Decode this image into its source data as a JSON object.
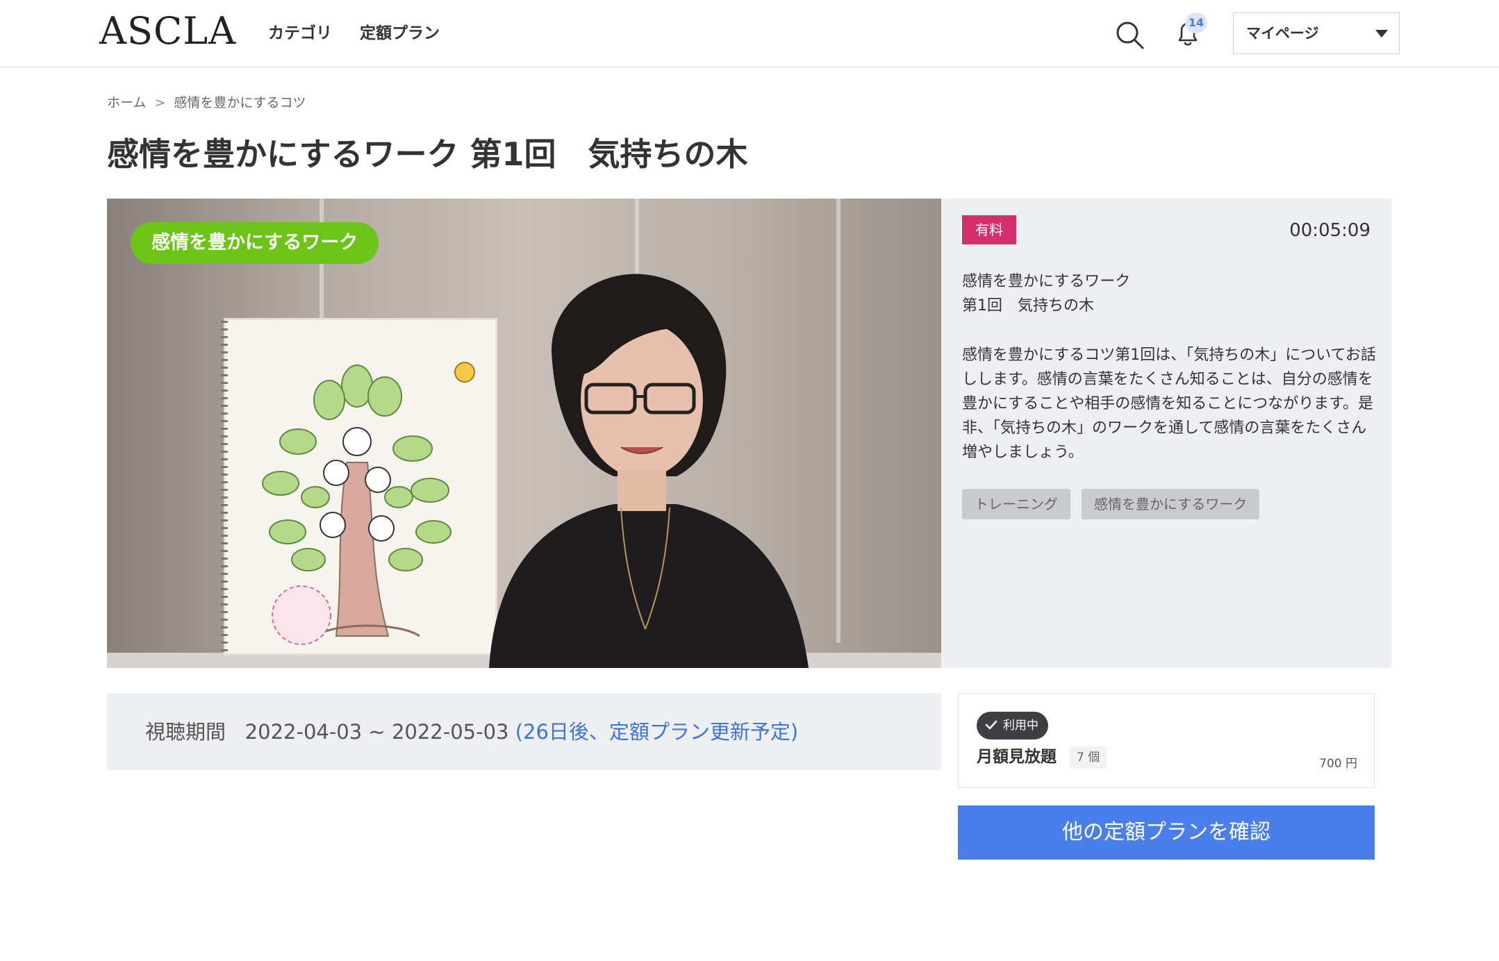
{
  "header": {
    "logo": "ASCLA",
    "nav": [
      "カテゴリ",
      "定額プラン"
    ],
    "notification_count": "14",
    "mypage_label": "マイページ"
  },
  "breadcrumb": [
    "ホーム",
    "感情を豊かにするコツ"
  ],
  "page_title": "感情を豊かにするワーク 第1回　気持ちの木",
  "video": {
    "label": "感情を豊かにするワーク"
  },
  "info": {
    "badge": "有料",
    "duration": "00:05:09",
    "title_lines": "感情を豊かにするワーク\n第1回　気持ちの木",
    "description": "感情を豊かにするコツ第1回は、「気持ちの木」についてお話しします。感情の言葉をたくさん知ることは、自分の感情を豊かにすることや相手の感情を知ることにつながります。是非、「気持ちの木」のワークを通して感情の言葉をたくさん増やしましょう。",
    "tags": [
      "トレーニング",
      "感情を豊かにするワーク"
    ]
  },
  "period": {
    "label": "視聴期間",
    "range": "2022-04-03 ~ 2022-05-03",
    "note": "(26日後、定額プラン更新予定)"
  },
  "plan": {
    "status": "利用中",
    "name": "月額見放題",
    "count": "7 個",
    "price": "700 円",
    "other_button": "他の定額プランを確認"
  },
  "colors": {
    "accent_blue": "#4a7eeb",
    "paid_pink": "#d42f6e",
    "video_label_green": "#6dc419",
    "link_blue": "#3d74d8"
  }
}
